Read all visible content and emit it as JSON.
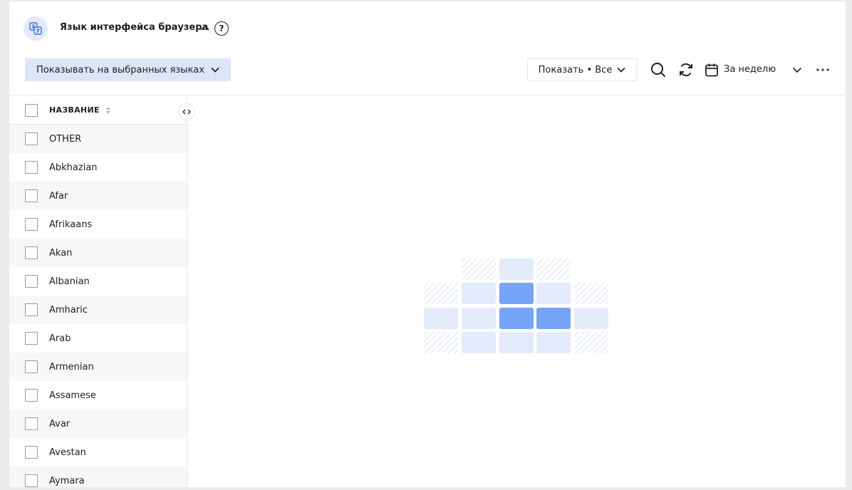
{
  "header": {
    "title": "Язык интерфейса браузера",
    "help": "?"
  },
  "toolbar": {
    "language_filter": "Показывать на выбранных языках",
    "show_label": "Показать • Все",
    "period": "За неделю"
  },
  "sidebar": {
    "column_title": "НАЗВАНИЕ",
    "rows": [
      "OTHER",
      "Abkhazian",
      "Afar",
      "Afrikaans",
      "Akan",
      "Albanian",
      "Amharic",
      "Arab",
      "Armenian",
      "Assamese",
      "Avar",
      "Avestan",
      "Aymara"
    ]
  },
  "colors": {
    "accent": "#75a3f7",
    "filter_bg": "#dce6f7",
    "empty_cell": "#e3ebfa"
  },
  "empty_state": {
    "illustration": "loading-grid"
  }
}
